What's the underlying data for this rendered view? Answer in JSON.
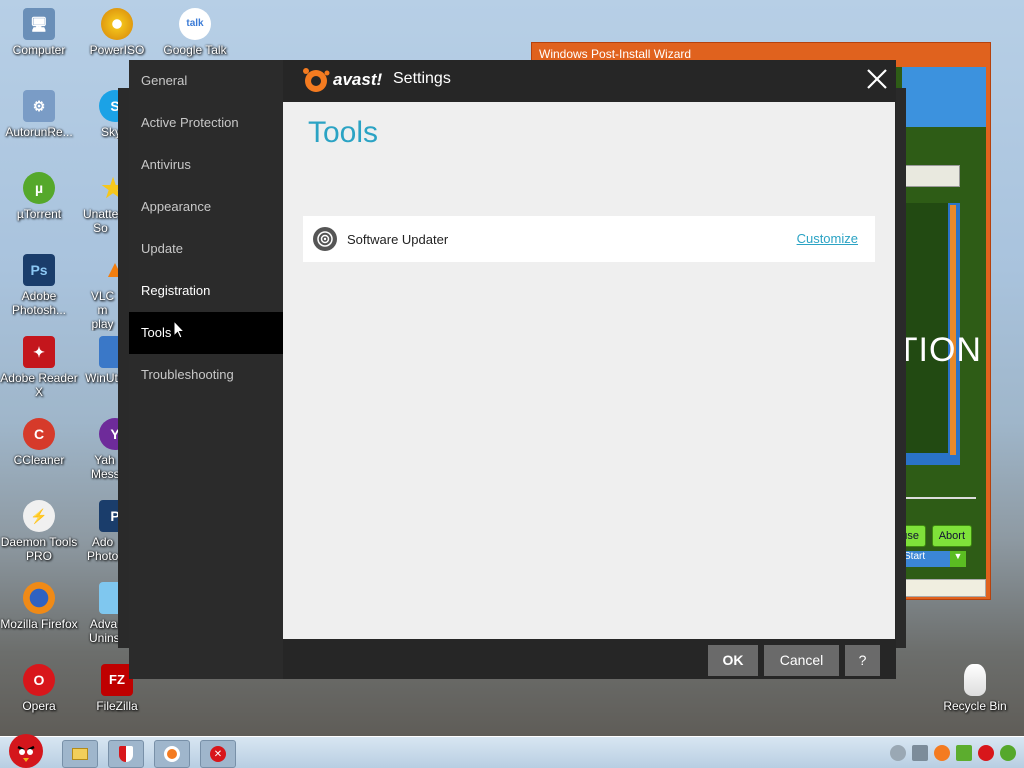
{
  "desktop": {
    "icons": [
      {
        "label": "Computer",
        "icon": "computer-icon"
      },
      {
        "label": "PowerISO",
        "icon": "poweriso-icon"
      },
      {
        "label": "Google Talk",
        "icon": "google-talk-icon",
        "glyph": "talk"
      },
      {
        "label": "AutorunRe...",
        "icon": "autorun-icon"
      },
      {
        "label": "Sky",
        "icon": "skype-icon",
        "glyph": "S"
      },
      {
        "label": "µTorrent",
        "icon": "utorrent-icon",
        "glyph": "µ"
      },
      {
        "label": "Unatte So",
        "icon": "unattended-icon"
      },
      {
        "label": "Adobe Photosh...",
        "icon": "photoshop-icon",
        "glyph": "Ps"
      },
      {
        "label": "VLC m play",
        "icon": "vlc-icon"
      },
      {
        "label": "Adobe Reader X",
        "icon": "adobe-reader-icon"
      },
      {
        "label": "WinUt",
        "icon": "winut-icon"
      },
      {
        "label": "CCleaner",
        "icon": "ccleaner-icon"
      },
      {
        "label": "Yah Messe",
        "icon": "yahoo-messenger-icon",
        "glyph": "Y"
      },
      {
        "label": "Daemon Tools PRO",
        "icon": "daemon-tools-icon",
        "glyph": "⚡"
      },
      {
        "label": "Ado Photo",
        "icon": "adobe-photo-icon",
        "glyph": "P"
      },
      {
        "label": "Mozilla Firefox",
        "icon": "firefox-icon"
      },
      {
        "label": "Adva Unins",
        "icon": "advanced-uninstaller-icon"
      },
      {
        "label": "Opera",
        "icon": "opera-icon",
        "glyph": "O"
      },
      {
        "label": "FileZilla",
        "icon": "filezilla-icon",
        "glyph": "FZ"
      },
      {
        "label": "Recycle Bin",
        "icon": "recycle-bin-icon"
      }
    ]
  },
  "wizard": {
    "title": "Windows Post-Install Wizard",
    "big_text": "ITION",
    "buttons": [
      "use",
      "Abort"
    ],
    "start_label": "Start"
  },
  "avast": {
    "logo_text": "avast!",
    "settings_label": "Settings",
    "nav": [
      {
        "label": "General",
        "active": false
      },
      {
        "label": "Active Protection",
        "active": false
      },
      {
        "label": "Antivirus",
        "active": false
      },
      {
        "label": "Appearance",
        "active": false
      },
      {
        "label": "Update",
        "active": false
      },
      {
        "label": "Registration",
        "active": false
      },
      {
        "label": "Tools",
        "active": true
      },
      {
        "label": "Troubleshooting",
        "active": false
      }
    ],
    "page_title": "Tools",
    "tools": [
      {
        "name": "Software Updater",
        "action": "Customize",
        "icon": "target-icon"
      }
    ],
    "footer": {
      "ok": "OK",
      "cancel": "Cancel",
      "help": "?"
    },
    "accent_color": "#2ba3c4",
    "brand_color": "#f47b20"
  },
  "taskbar": {
    "buttons": [
      "folder-icon",
      "avast-shield-icon",
      "avast-orange-icon",
      "error-icon"
    ],
    "tray": [
      "network-icon",
      "volume-icon",
      "avast-tray-icon",
      "yahoo-tray-icon",
      "security-tray-icon",
      "utorrent-tray-icon"
    ]
  }
}
